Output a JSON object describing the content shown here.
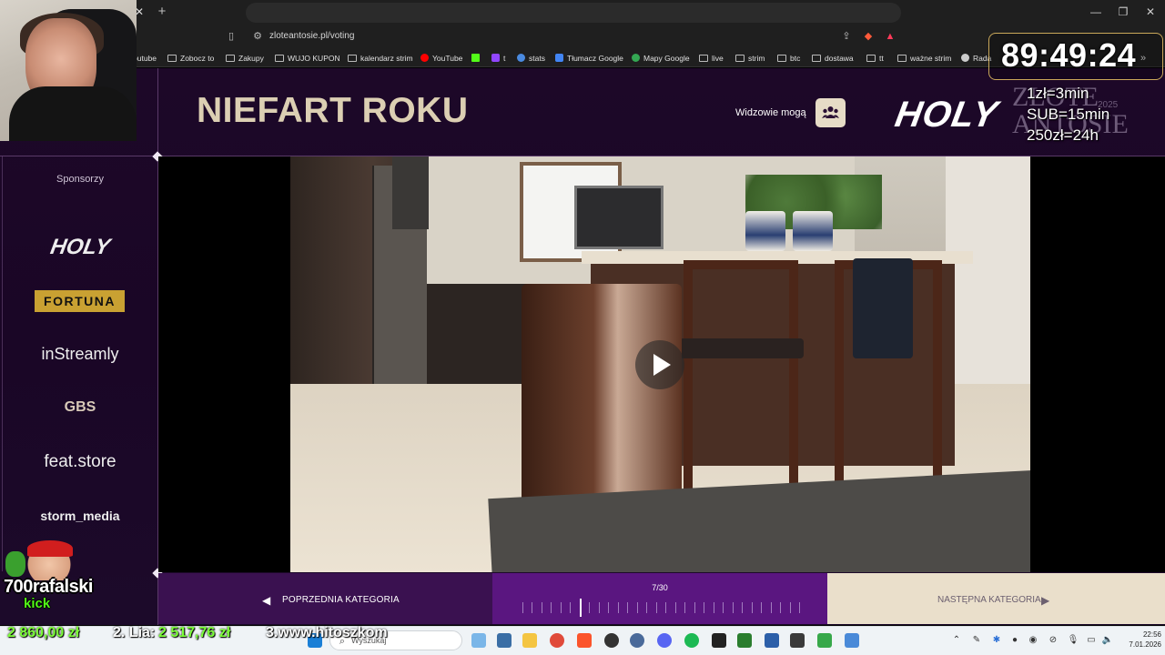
{
  "browser": {
    "url": "zloteantosie.pl/voting",
    "tab_close": "✕",
    "tab_new": "+",
    "bookmarks": [
      {
        "label": "outube"
      },
      {
        "label": "Zobocz to"
      },
      {
        "label": "Zakupy"
      },
      {
        "label": "WUJO KUPON"
      },
      {
        "label": "kalendarz strim"
      },
      {
        "label": "YouTube"
      },
      {
        "label": "t"
      },
      {
        "label": "stats"
      },
      {
        "label": "Tłumacz Google"
      },
      {
        "label": "Mapy Google"
      },
      {
        "label": "live"
      },
      {
        "label": "strim"
      },
      {
        "label": "btc"
      },
      {
        "label": "dostawa"
      },
      {
        "label": "tt"
      },
      {
        "label": "ważne strim"
      },
      {
        "label": "Rada"
      }
    ]
  },
  "page": {
    "title": "NIEFART ROKU",
    "viewers_label": "Widzowie mogą",
    "brand": "HOLY",
    "event_name_1": "ZŁOTE",
    "event_name_2": "ANTOSIE",
    "event_year": "2025",
    "sponsors_label": "Sponsorzy",
    "sponsors": [
      "HOLY",
      "FORTUNA",
      "inStreamly",
      "GBS",
      "feat.store",
      "storm_media"
    ]
  },
  "navigation": {
    "prev_label": "POPRZEDNIA KATEGORIA",
    "next_label": "NASTĘPNA KATEGORIA",
    "progress_text": "7/30",
    "current": 7,
    "total": 30
  },
  "stream_overlay": {
    "timer": "89:49:24",
    "rates": [
      "1zł=3min",
      "SUB=15min",
      "250zł=24h"
    ],
    "logo_name": "700rafalski",
    "logo_sub": "kick",
    "logo_partial": "rafalski",
    "ticker": [
      {
        "text": "2 860,00 zł",
        "color": "#7dff3a"
      },
      {
        "text": "2. Lia:",
        "color": "#ffffff"
      },
      {
        "text": "2 517,76 zł",
        "color": "#7dff3a"
      },
      {
        "text": "3.www.hitoszkom",
        "color": "#ffffff"
      }
    ]
  },
  "taskbar": {
    "search_placeholder": "Wyszukaj",
    "time": "22:56",
    "date": "7.01.2026"
  },
  "colors": {
    "accent_purple": "#5a1680",
    "cream": "#eadfcb",
    "title_gold": "#dccfb3"
  }
}
